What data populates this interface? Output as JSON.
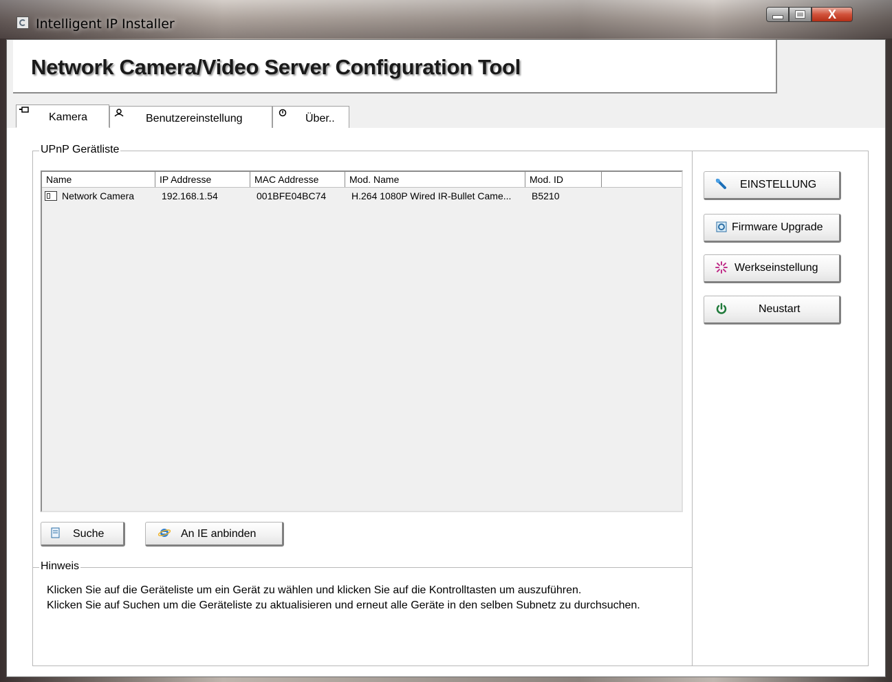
{
  "window": {
    "title": "Intelligent IP Installer",
    "controls": {
      "minimize": "minimize",
      "maximize": "maximize",
      "close": "X"
    }
  },
  "header": {
    "title": "Network Camera/Video Server Configuration Tool"
  },
  "tabs": [
    {
      "label": "Kamera",
      "icon": "camera-icon",
      "active": true
    },
    {
      "label": "Benutzereinstellung",
      "icon": "user-icon",
      "active": false
    },
    {
      "label": "Über..",
      "icon": "info-icon",
      "active": false
    }
  ],
  "device_group": {
    "label": "UPnP Gerätliste"
  },
  "device_list": {
    "columns": [
      "Name",
      "IP Addresse",
      "MAC Addresse",
      "Mod. Name",
      "Mod. ID"
    ],
    "rows": [
      {
        "name": "Network Camera",
        "ip": "192.168.1.54",
        "mac": "001BFE04BC74",
        "mod_name": "H.264 1080P Wired IR-Bullet Came...",
        "mod_id": "B5210"
      }
    ]
  },
  "actions": {
    "einstellung": "EINSTELLUNG",
    "firmware": "Firmware Upgrade",
    "werks": "Werkseinstellung",
    "neustart": "Neustart",
    "suche": "Suche",
    "an_ie": "An IE anbinden"
  },
  "hint": {
    "label": "Hinweis",
    "line1": "Klicken Sie auf die Geräteliste um ein Gerät zu wählen und klicken Sie auf die Kontrolltasten um auszuführen.",
    "line2": "Klicken Sie auf Suchen um die Geräteliste zu aktualisieren und erneut alle Geräte in den selben Subnetz zu durchsuchen."
  },
  "colors": {
    "accent_close": "#c8442a",
    "restart_icon": "#1f7a3a",
    "factory_icon": "#c0308a"
  }
}
